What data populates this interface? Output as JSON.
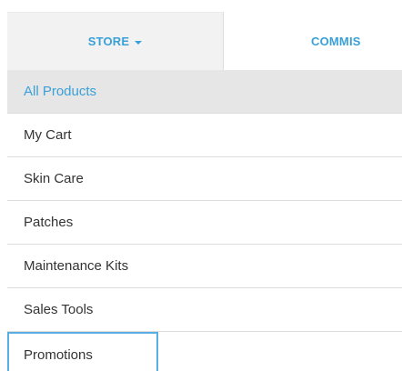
{
  "topnav": {
    "tabs": [
      {
        "label": "STORE"
      },
      {
        "label": "COMMIS"
      }
    ]
  },
  "menu": {
    "items": [
      {
        "label": "All Products"
      },
      {
        "label": "My Cart"
      },
      {
        "label": "Skin Care"
      },
      {
        "label": "Patches"
      },
      {
        "label": "Maintenance Kits"
      },
      {
        "label": "Sales Tools"
      },
      {
        "label": "Promotions"
      }
    ]
  },
  "colors": {
    "accent": "#3aa0d8",
    "active_bg": "#e6e6e6",
    "focus_border": "#5aaee4",
    "divider": "#dcdcdc"
  },
  "icons": {
    "store_dropdown": "caret-down-icon"
  }
}
